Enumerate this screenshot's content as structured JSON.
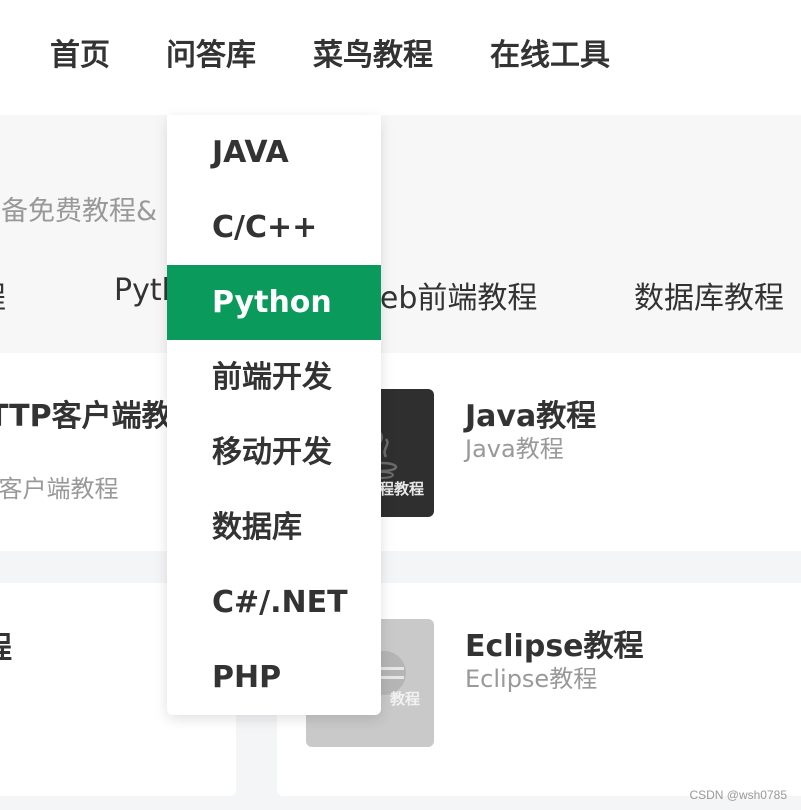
{
  "topnav": {
    "home": "首页",
    "qa": "问答库",
    "runoob": "菜鸟教程",
    "tools": "在线工具"
  },
  "hero": {
    "subtitle": "必备免费教程&",
    "categories": [
      "程",
      "Pyth",
      "Web前端教程",
      "数据库教程"
    ]
  },
  "cards": [
    {
      "title": "TTP客户端教",
      "desc": "P客户端教程"
    },
    {
      "title": "Java教程",
      "desc": "Java教程",
      "thumb_text": "程教程",
      "thumb_color": "#2f2f2f"
    },
    {
      "title": "程"
    },
    {
      "title": "Eclipse教程",
      "desc": "Eclipse教程",
      "thumb_text": "教程",
      "thumb_color": "#c9c9c9"
    }
  ],
  "dropdown": {
    "active_index": 2,
    "active_color": "#0a9a5c",
    "items": [
      "JAVA",
      "C/C++",
      "Python",
      "前端开发",
      "移动开发",
      "数据库",
      "C#/.NET",
      "PHP"
    ]
  },
  "watermark": "CSDN @wsh0785"
}
